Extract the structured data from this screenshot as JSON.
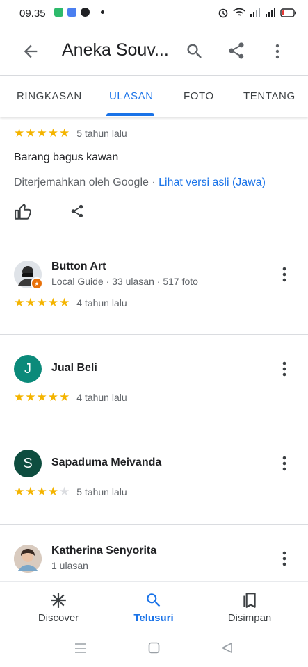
{
  "status": {
    "time": "09.35"
  },
  "appbar": {
    "title": "Aneka Souv..."
  },
  "tabs": [
    {
      "label": "RINGKASAN"
    },
    {
      "label": "ULASAN"
    },
    {
      "label": "FOTO"
    },
    {
      "label": "TENTANG"
    }
  ],
  "first_review": {
    "rating": 5,
    "when": "5 tahun lalu",
    "text": "Barang bagus kawan",
    "translated_by": "Diterjemahkan oleh Google",
    "separator": "·",
    "original_link": "Lihat versi asli (Jawa)"
  },
  "reviews": [
    {
      "initial": "",
      "name": "Button Art",
      "meta": "Local Guide · 33 ulasan · 517 foto",
      "rating": 5,
      "when": "4 tahun lalu",
      "avatar_color": "#e8eaed"
    },
    {
      "initial": "J",
      "name": "Jual Beli",
      "meta": "",
      "rating": 5,
      "when": "4 tahun lalu",
      "avatar_color": "#0b8a7a"
    },
    {
      "initial": "S",
      "name": "Sapaduma Meivanda",
      "meta": "",
      "rating": 4,
      "when": "5 tahun lalu",
      "avatar_color": "#0e4d3f"
    },
    {
      "initial": "",
      "name": "Katherina Senyorita",
      "meta": "1 ulasan",
      "rating": null,
      "when": "",
      "avatar_color": "#c9b5a4"
    }
  ],
  "bottom_nav": [
    {
      "label": "Discover",
      "icon": "asterisk-icon"
    },
    {
      "label": "Telusuri",
      "icon": "search-icon"
    },
    {
      "label": "Disimpan",
      "icon": "bookmarks-icon"
    }
  ],
  "colors": {
    "accent": "#1a73e8",
    "star": "#f4b400"
  }
}
